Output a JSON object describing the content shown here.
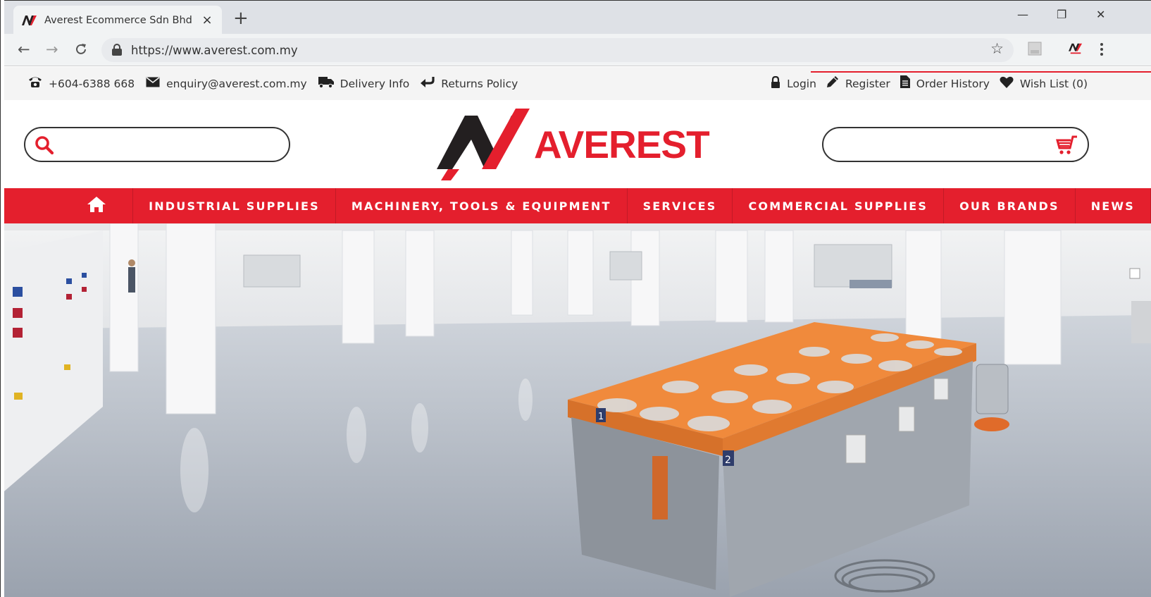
{
  "browser": {
    "tab_title": "Averest Ecommerce Sdn Bhd",
    "tab_close": "×",
    "new_tab": "+",
    "url": "https://www.averest.com.my",
    "win_min": "—",
    "win_restore": "❐",
    "win_close": "✕",
    "back": "←",
    "forward": "→",
    "reload": "C",
    "star": "☆"
  },
  "infobar": {
    "phone": "+604-6388 668",
    "email": "enquiry@averest.com.my",
    "delivery": "Delivery Info",
    "returns": "Returns Policy",
    "login": "Login",
    "register": "Register",
    "order_history": "Order History",
    "wish_list": "Wish List (0)"
  },
  "header": {
    "logo_text": "AVEREST",
    "search_placeholder": ""
  },
  "nav": {
    "items": [
      "INDUSTRIAL SUPPLIES",
      "MACHINERY, TOOLS & EQUIPMENT",
      "SERVICES",
      "COMMERCIAL SUPPLIES",
      "OUR BRANDS",
      "NEWS"
    ]
  },
  "hero": {
    "bin_labels": [
      "1",
      "2"
    ]
  },
  "colors": {
    "brand_red": "#e41f2d",
    "dark": "#231f20"
  },
  "icons": {
    "phone": "phone-icon",
    "email": "envelope-icon",
    "delivery": "truck-icon",
    "returns": "return-arrow-icon",
    "login": "lock-icon",
    "register": "pencil-icon",
    "order_history": "document-icon",
    "wish_list": "heart-icon",
    "search": "search-icon",
    "cart": "cart-icon",
    "home": "home-icon"
  }
}
